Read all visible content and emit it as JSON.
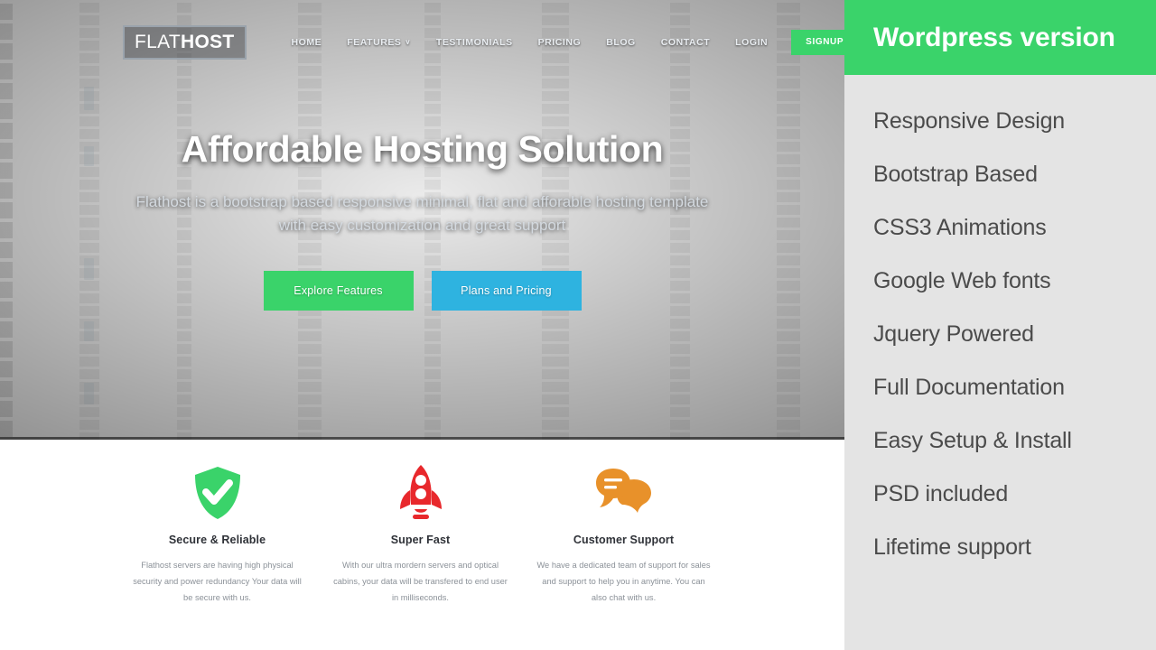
{
  "site": {
    "logo": {
      "light": "FLAT",
      "bold": "HOST"
    },
    "nav": [
      {
        "label": "HOME",
        "caret": ""
      },
      {
        "label": "FEATURES",
        "caret": "∨"
      },
      {
        "label": "TESTIMONIALS",
        "caret": ""
      },
      {
        "label": "PRICING",
        "caret": ""
      },
      {
        "label": "BLOG",
        "caret": ""
      },
      {
        "label": "CONTACT",
        "caret": ""
      },
      {
        "label": "LOGIN",
        "caret": ""
      }
    ],
    "signup_label": "SIGNUP",
    "hero": {
      "title": "Affordable Hosting Solution",
      "subtitle": "Flathost is a bootstrap based responsive minimal, flat and afforable hosting template with easy customization and great support",
      "primary_button": "Explore Features",
      "secondary_button": "Plans and Pricing"
    },
    "features": [
      {
        "icon": "shield-check-icon",
        "color": "#3ad36a",
        "title": "Secure & Reliable",
        "text": "Flathost servers are having high physical security and power redundancy Your data will be secure with us."
      },
      {
        "icon": "rocket-icon",
        "color": "#e8282c",
        "title": "Super Fast",
        "text": "With our ultra mordern servers and optical cabins, your data will be transfered to end user in milliseconds."
      },
      {
        "icon": "chat-bubbles-icon",
        "color": "#e8912a",
        "title": "Customer Support",
        "text": "We have a dedicated team of support for sales and support to help you in anytime. You can also chat with us."
      }
    ]
  },
  "sidebar": {
    "header": "Wordpress version",
    "accent_color": "#3ad36a",
    "background_color": "#e4e4e4",
    "items": [
      {
        "label": "Responsive Design"
      },
      {
        "label": "Bootstrap Based"
      },
      {
        "label": "CSS3 Animations"
      },
      {
        "label": "Google Web fonts"
      },
      {
        "label": "Jquery Powered"
      },
      {
        "label": "Full Documentation"
      },
      {
        "label": "Easy Setup & Install"
      },
      {
        "label": "PSD included"
      },
      {
        "label": "Lifetime support"
      }
    ]
  }
}
